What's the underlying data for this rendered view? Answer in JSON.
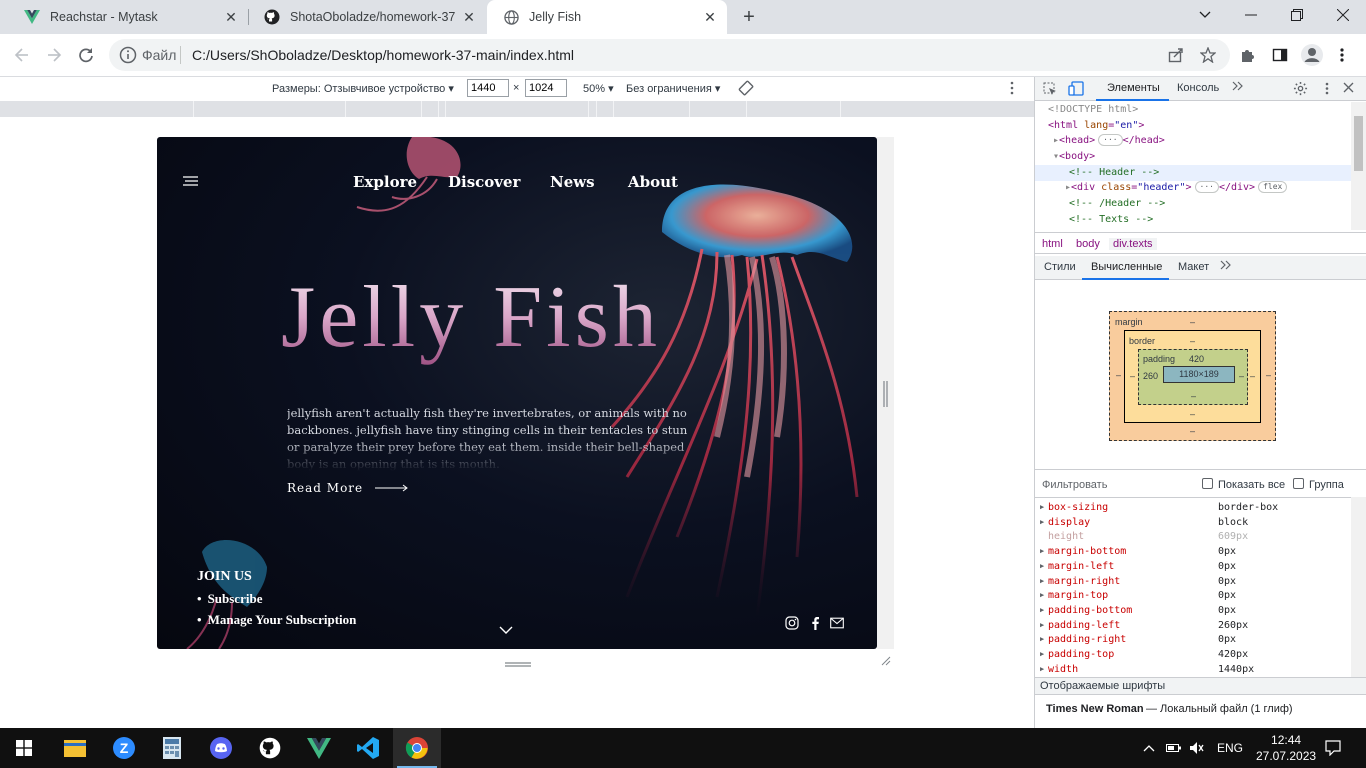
{
  "browser": {
    "tabs": [
      {
        "title": "Reachstar - Mytask",
        "icon": "vue-icon",
        "active": false
      },
      {
        "title": "ShotaOboladze/homework-37",
        "icon": "github-icon",
        "active": false
      },
      {
        "title": "Jelly Fish",
        "icon": "globe-icon",
        "active": true
      }
    ],
    "protocol_label": "Файл",
    "url": "C:/Users/ShOboladze/Desktop/homework-37-main/index.html"
  },
  "device_toolbar": {
    "dimensions_label": "Размеры: Отзывчивое устройство",
    "width": "1440",
    "times": "×",
    "height": "1024",
    "zoom": "50%",
    "throttle": "Без ограничения"
  },
  "page": {
    "nav": [
      "Explore",
      "Discover",
      "News",
      "About"
    ],
    "title": "Jelly Fish",
    "description": "jellyfish aren't actually fish they're invertebrates, or animals with no backbones. jellyfish have tiny stinging cells in their tentacles to stun or paralyze their prey before they eat them. inside their bell-shaped body is an opening that is its mouth.",
    "read_more": "Read More",
    "join_title": "JOIN US",
    "join_items": [
      "Subscribe",
      "Manage Your Subscription"
    ],
    "colors": {
      "title_gradient_top": "#f4e9f2",
      "title_gradient_bottom": "#9b4d80",
      "background": "#0b1020"
    }
  },
  "devtools": {
    "tabs": [
      "Элементы",
      "Консоль"
    ],
    "dom": {
      "doctype": "<!DOCTYPE html>",
      "html_open": "<html",
      "html_attr": "lang",
      "html_val": "\"en\"",
      "head": "<head>",
      "head_close": "</head>",
      "body": "<body>",
      "comment_header": "<!-- Header -->",
      "div_header_open": "<div",
      "div_header_attr": "class",
      "div_header_val": "\"header\"",
      "div_close": "</div>",
      "badge_flex": "flex",
      "comment_header_end": "<!-- /Header -->",
      "comment_texts": "<!-- Texts -->"
    },
    "breadcrumbs": [
      "html",
      "body",
      "div.texts"
    ],
    "subtabs": [
      "Стили",
      "Вычисленные",
      "Макет"
    ],
    "boxmodel": {
      "margin_label": "margin",
      "border_label": "border",
      "padding_label": "padding",
      "padding_top": "420",
      "padding_left": "260",
      "content": "1180×189",
      "dash": "–"
    },
    "filter_label": "Фильтровать",
    "show_all": "Показать все",
    "group": "Группа",
    "computed": [
      {
        "name": "box-sizing",
        "value": "border-box",
        "inherited": false
      },
      {
        "name": "display",
        "value": "block",
        "inherited": false
      },
      {
        "name": "height",
        "value": "609px",
        "inherited": true
      },
      {
        "name": "margin-bottom",
        "value": "0px",
        "inherited": false
      },
      {
        "name": "margin-left",
        "value": "0px",
        "inherited": false
      },
      {
        "name": "margin-right",
        "value": "0px",
        "inherited": false
      },
      {
        "name": "margin-top",
        "value": "0px",
        "inherited": false
      },
      {
        "name": "padding-bottom",
        "value": "0px",
        "inherited": false
      },
      {
        "name": "padding-left",
        "value": "260px",
        "inherited": false
      },
      {
        "name": "padding-right",
        "value": "0px",
        "inherited": false
      },
      {
        "name": "padding-top",
        "value": "420px",
        "inherited": false
      },
      {
        "name": "width",
        "value": "1440px",
        "inherited": false
      }
    ],
    "fonts_title": "Отображаемые шрифты",
    "font_name": "Times New Roman",
    "font_source": "— Локальный файл (1 глиф)"
  },
  "taskbar": {
    "apps": [
      "file-explorer-icon",
      "zoom-icon",
      "calculator-icon",
      "discord-icon",
      "github-desktop-icon",
      "vue-icon",
      "vscode-icon",
      "chrome-icon"
    ],
    "lang": "ENG",
    "time": "12:44",
    "date": "27.07.2023"
  }
}
